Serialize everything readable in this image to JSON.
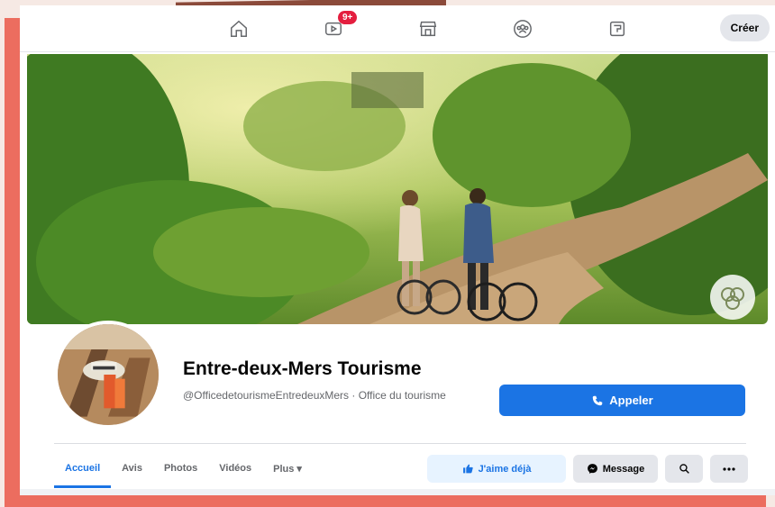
{
  "topbar": {
    "nav": [
      {
        "icon": "home-icon"
      },
      {
        "icon": "video-icon",
        "badge": "9+"
      },
      {
        "icon": "marketplace-icon"
      },
      {
        "icon": "groups-icon"
      },
      {
        "icon": "gaming-icon"
      }
    ],
    "create_label": "Créer"
  },
  "profile": {
    "name": "Entre-deux-Mers Tourisme",
    "subtitle": "@OfficedetourismeEntredeuxMers · Office du tourisme",
    "call_label": "Appeler"
  },
  "tabs": [
    {
      "label": "Accueil",
      "active": true
    },
    {
      "label": "Avis"
    },
    {
      "label": "Photos"
    },
    {
      "label": "Vidéos"
    },
    {
      "label": "Plus ▾"
    }
  ],
  "actions": {
    "like_label": "J'aime déjà",
    "message_label": "Message"
  },
  "colors": {
    "accent": "#1b74e4",
    "frame": "#ec6d5f",
    "badge": "#e41e3f"
  }
}
